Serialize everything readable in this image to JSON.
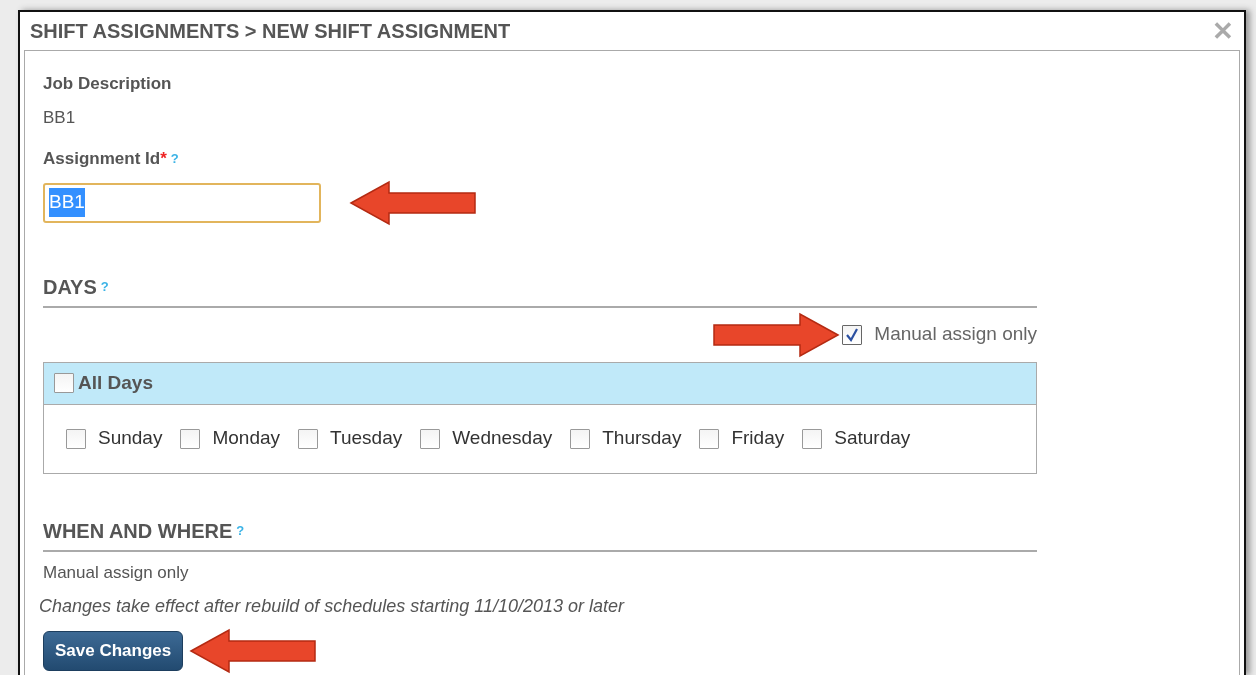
{
  "dialog": {
    "title": "SHIFT ASSIGNMENTS > NEW SHIFT ASSIGNMENT",
    "close": "✕"
  },
  "job_description": {
    "label": "Job Description",
    "value": "BB1"
  },
  "assignment_id": {
    "label": "Assignment Id",
    "required": "*",
    "help": "?",
    "value": "BB1",
    "selected_text": true,
    "focused": true,
    "marked_by_arrow": true
  },
  "days": {
    "heading": "DAYS",
    "help": "?",
    "manual_assign": {
      "label": "Manual assign only",
      "checked": true,
      "marked_by_arrow": true
    },
    "all_days": {
      "label": "All Days",
      "checked": false
    },
    "items": [
      {
        "label": "Sunday",
        "checked": false
      },
      {
        "label": "Monday",
        "checked": false
      },
      {
        "label": "Tuesday",
        "checked": false
      },
      {
        "label": "Wednesday",
        "checked": false
      },
      {
        "label": "Thursday",
        "checked": false
      },
      {
        "label": "Friday",
        "checked": false
      },
      {
        "label": "Saturday",
        "checked": false
      }
    ]
  },
  "when_and_where": {
    "heading": "WHEN AND WHERE",
    "help": "?",
    "value": "Manual assign only",
    "note": "Changes take effect after rebuild of schedules starting 11/10/2013 or later"
  },
  "save_button": {
    "label": "Save Changes",
    "marked_by_arrow": true
  }
}
